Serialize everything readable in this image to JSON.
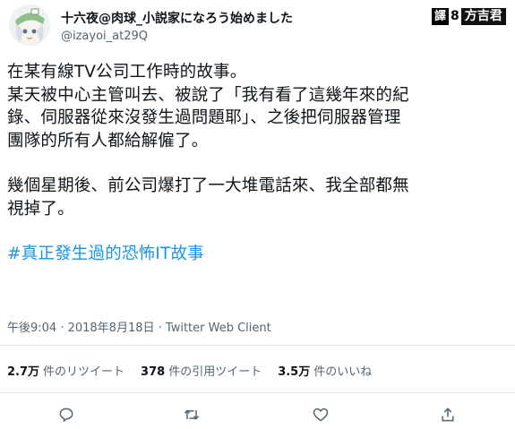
{
  "user": {
    "display_name": "十六夜@肉球_小説家になろう始めました",
    "handle": "@izayoi_at29Q"
  },
  "watermark": {
    "char": "譯",
    "connector": "8",
    "brand": "方吉君"
  },
  "tweet": {
    "lines_p1": [
      "在某有線TV公司工作時的故事。",
      "某天被中心主管叫去、被說了「我有看了這幾年來的紀",
      "錄、伺服器從來沒發生過問題耶」、之後把伺服器管理",
      "團隊的所有人都給解僱了。"
    ],
    "lines_p2": [
      "幾個星期後、前公司爆打了一大堆電話來、我全部都無",
      "視掉了。"
    ],
    "hashtag": "#真正發生過的恐怖IT故事"
  },
  "meta": {
    "timestamp": "午後9:04 · 2018年8月18日",
    "separator": " · ",
    "client": "Twitter Web Client"
  },
  "stats": {
    "retweets_count": "2.7万",
    "retweets_label": "件のリツイート",
    "quotes_count": "378",
    "quotes_label": "件の引用ツイート",
    "likes_count": "3.5万",
    "likes_label": "件のいいね"
  },
  "icons": {
    "reply": "reply-icon",
    "retweet": "retweet-icon",
    "like": "like-icon",
    "share": "share-icon"
  }
}
